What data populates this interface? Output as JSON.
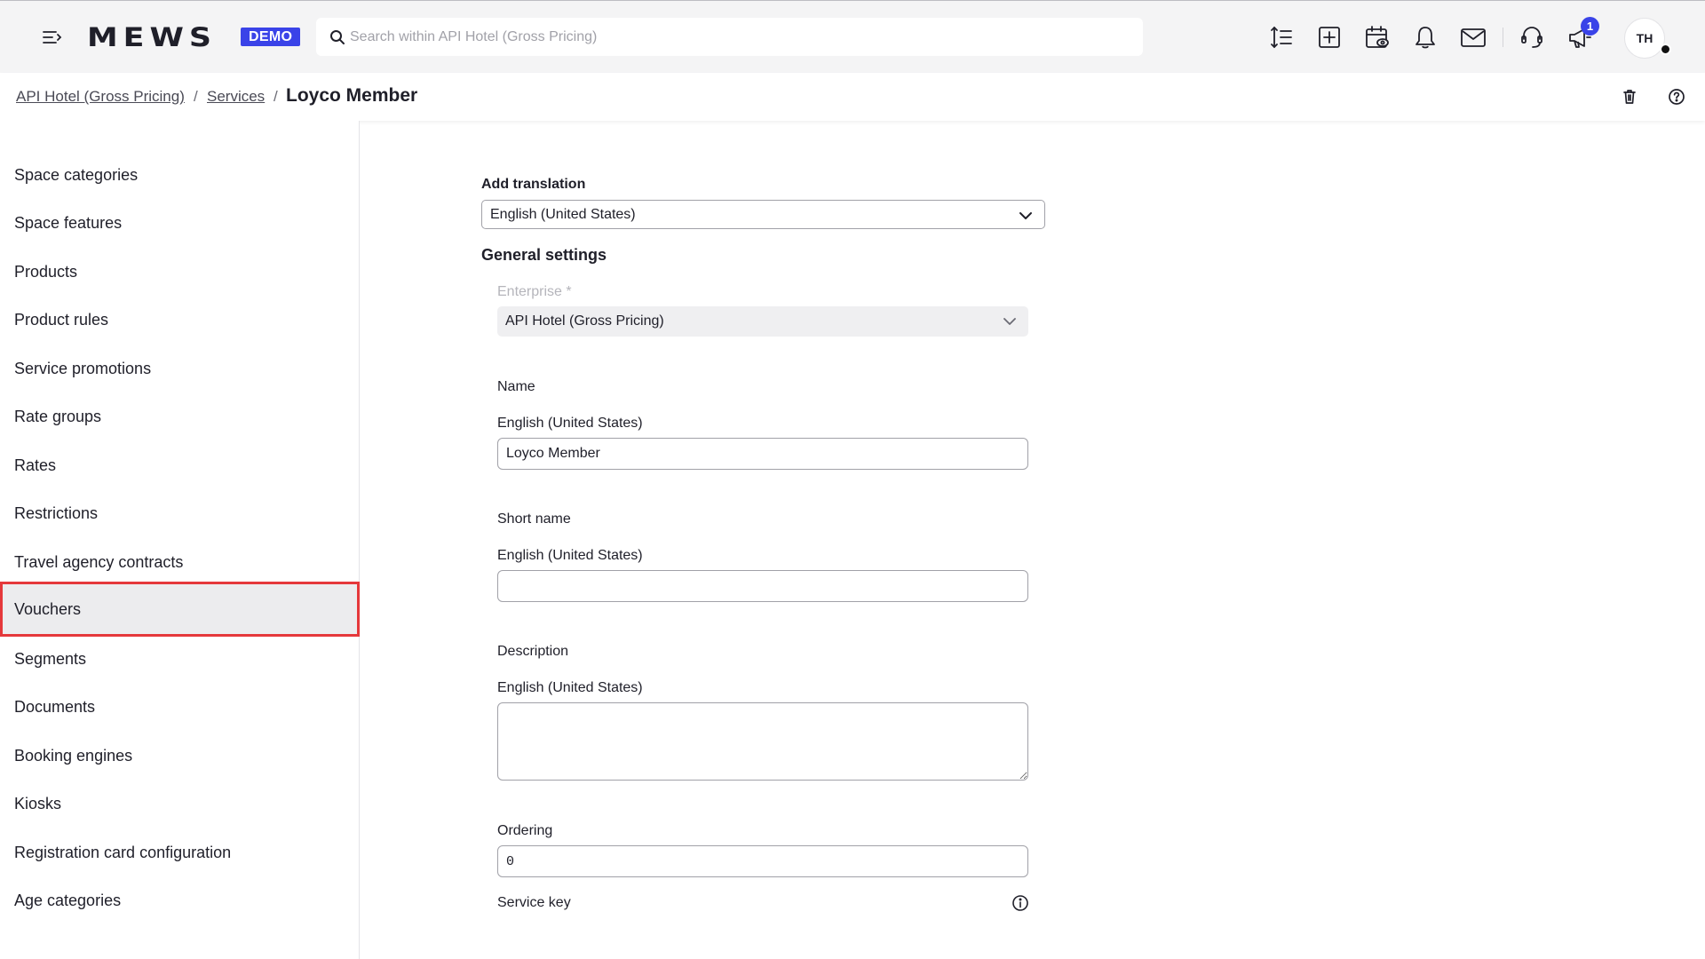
{
  "topbar": {
    "logo_text": "MEWS",
    "demo_badge": "DEMO",
    "search_placeholder": "Search within API Hotel (Gross Pricing)",
    "notification_count": "1",
    "avatar_initials": "TH"
  },
  "breadcrumb": {
    "items": [
      "API Hotel (Gross Pricing)",
      "Services"
    ],
    "separator": "/",
    "current": "Loyco Member"
  },
  "sidebar": {
    "items": [
      "Space categories",
      "Space features",
      "Products",
      "Product rules",
      "Service promotions",
      "Rate groups",
      "Rates",
      "Restrictions",
      "Travel agency contracts",
      "Vouchers",
      "Segments",
      "Documents",
      "Booking engines",
      "Kiosks",
      "Registration card configuration",
      "Age categories"
    ],
    "active_item": "Vouchers"
  },
  "form": {
    "add_translation": {
      "label": "Add translation",
      "value": "English (United States)"
    },
    "general_settings_title": "General settings",
    "enterprise": {
      "label": "Enterprise *",
      "value": "API Hotel (Gross Pricing)"
    },
    "name": {
      "label": "Name",
      "language": "English (United States)",
      "value": "Loyco Member"
    },
    "short_name": {
      "label": "Short name",
      "language": "English (United States)",
      "value": ""
    },
    "description": {
      "label": "Description",
      "language": "English (United States)",
      "value": ""
    },
    "ordering": {
      "label": "Ordering",
      "value": "0"
    },
    "service_key": {
      "label": "Service key"
    }
  },
  "colors": {
    "accent": "#3a43e8",
    "highlight_border": "#e5383b",
    "topbar_bg": "#f4f4f5"
  }
}
